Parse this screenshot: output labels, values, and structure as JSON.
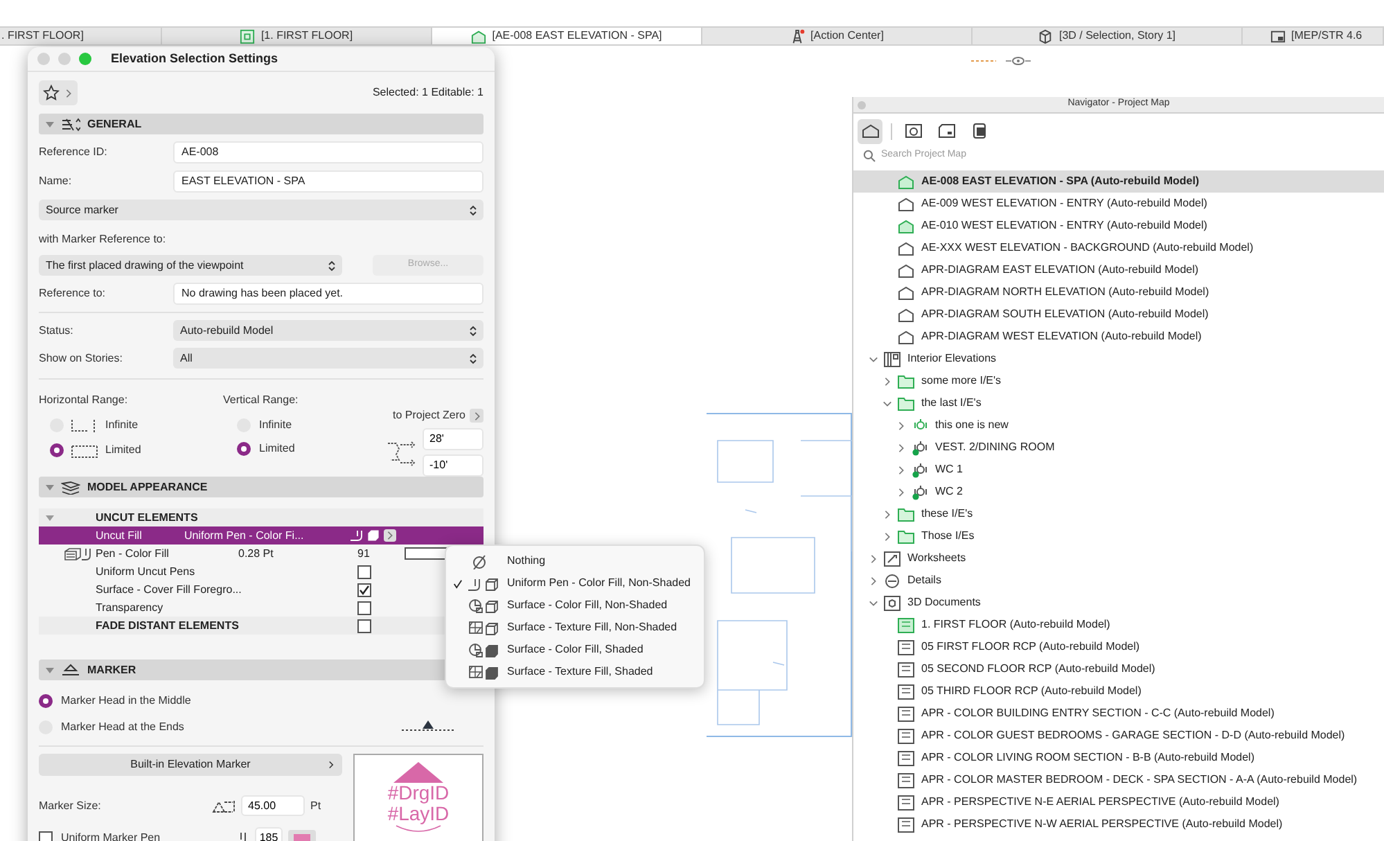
{
  "tabs": [
    {
      "label": ". FIRST FLOOR]",
      "kind": "none",
      "selected": false
    },
    {
      "label": "[1. FIRST FLOOR]",
      "kind": "plan",
      "selected": false
    },
    {
      "label": "[AE-008 EAST ELEVATION - SPA]",
      "kind": "elevation",
      "selected": true
    },
    {
      "label": "[Action Center]",
      "kind": "action",
      "selected": false
    },
    {
      "label": "[3D / Selection, Story 1]",
      "kind": "cube",
      "selected": false
    },
    {
      "label": "[MEP/STR 4.6",
      "kind": "layout",
      "selected": false
    }
  ],
  "dialog": {
    "title": "Elevation Selection Settings",
    "selection_info": "Selected: 1 Editable: 1",
    "general": {
      "title": "GENERAL",
      "expanded": true,
      "reference_id": {
        "label": "Reference ID:",
        "value": "AE-008"
      },
      "name": {
        "label": "Name:",
        "value": "EAST ELEVATION - SPA"
      },
      "marker_type": "Source marker",
      "marker_reference_label": "with Marker Reference to:",
      "marker_reference": "The first placed drawing of the viewpoint",
      "browse": {
        "label": "Browse...",
        "disabled": true
      },
      "reference_to": {
        "label": "Reference to:",
        "value": "No drawing has been placed yet."
      },
      "status": {
        "label": "Status:",
        "value": "Auto-rebuild Model"
      },
      "stories": {
        "label": "Show on Stories:",
        "value": "All"
      },
      "horizontal_range": {
        "label": "Horizontal Range:",
        "options": [
          {
            "label": "Infinite",
            "selected": false
          },
          {
            "label": "Limited",
            "selected": true
          }
        ]
      },
      "vertical_range": {
        "label": "Vertical Range:",
        "options": [
          {
            "label": "Infinite",
            "selected": false
          },
          {
            "label": "Limited",
            "selected": true
          }
        ]
      },
      "project_zero": "to Project Zero",
      "top": "28'",
      "bottom": "-10'"
    },
    "model_appearance": {
      "title": "MODEL APPEARANCE",
      "expanded": true,
      "rows": [
        {
          "kind": "group",
          "label": "UNCUT ELEMENTS",
          "expanded": true
        },
        {
          "kind": "option",
          "label": "Uncut Fill",
          "value": "Uniform Pen - Color Fi...",
          "selected": true
        },
        {
          "kind": "pen",
          "label": "Pen - Color Fill",
          "value": "0.28 Pt",
          "number": "91"
        },
        {
          "kind": "check",
          "label": "Uniform Uncut Pens",
          "checked": false
        },
        {
          "kind": "check",
          "label": "Surface - Cover Fill Foregro...",
          "checked": true
        },
        {
          "kind": "check",
          "label": "Transparency",
          "checked": false
        },
        {
          "kind": "group-check",
          "label": "FADE DISTANT ELEMENTS",
          "checked": false
        }
      ]
    },
    "marker": {
      "title": "MARKER",
      "expanded": true,
      "head_options": [
        {
          "label": "Marker Head in the Middle",
          "selected": true
        },
        {
          "label": "Marker Head at the Ends",
          "selected": false
        }
      ],
      "builtin_button": "Built-in Elevation Marker",
      "size": {
        "label": "Marker Size:",
        "value": "45.00",
        "unit": "Pt"
      },
      "uniform_pen": {
        "label": "Uniform Marker Pen",
        "checked": false,
        "pen": "185",
        "color": "#e27bb0"
      },
      "preview": [
        "#DrgID",
        "#LayID"
      ]
    }
  },
  "fill_menu": {
    "items": [
      {
        "kind": "none",
        "label": "Nothing",
        "selected": false
      },
      {
        "kind": "pen",
        "label": "Uniform Pen - Color Fill, Non-Shaded",
        "selected": true
      },
      {
        "kind": "surface-color",
        "label": "Surface - Color Fill, Non-Shaded",
        "selected": false
      },
      {
        "kind": "surface-texture",
        "label": "Surface - Texture Fill, Non-Shaded",
        "selected": false
      },
      {
        "kind": "surface-color-shaded",
        "label": "Surface - Color Fill, Shaded",
        "selected": false
      },
      {
        "kind": "surface-texture-shaded",
        "label": "Surface - Texture Fill, Shaded",
        "selected": false
      }
    ]
  },
  "navigator": {
    "title": "Navigator - Project Map",
    "view_buttons": [
      {
        "kind": "project",
        "selected": true
      },
      {
        "kind": "view",
        "selected": false
      },
      {
        "kind": "layout",
        "selected": false
      },
      {
        "kind": "publisher",
        "selected": false
      }
    ],
    "search_placeholder": "Search Project Map",
    "elevations": [
      {
        "label": "AE-008 EAST ELEVATION - SPA (Auto-rebuild Model)",
        "kind": "elevation-green",
        "selected": true
      },
      {
        "label": "AE-009 WEST ELEVATION - ENTRY (Auto-rebuild Model)",
        "kind": "elevation",
        "selected": false
      },
      {
        "label": "AE-010 WEST ELEVATION - ENTRY (Auto-rebuild Model)",
        "kind": "elevation-green",
        "selected": false
      },
      {
        "label": "AE-XXX WEST ELEVATION - BACKGROUND (Auto-rebuild Model)",
        "kind": "elevation",
        "selected": false
      },
      {
        "label": "APR-DIAGRAM EAST ELEVATION (Auto-rebuild Model)",
        "kind": "elevation",
        "selected": false
      },
      {
        "label": "APR-DIAGRAM NORTH ELEVATION (Auto-rebuild Model)",
        "kind": "elevation",
        "selected": false
      },
      {
        "label": "APR-DIAGRAM SOUTH ELEVATION (Auto-rebuild Model)",
        "kind": "elevation",
        "selected": false
      },
      {
        "label": "APR-DIAGRAM WEST ELEVATION (Auto-rebuild Model)",
        "kind": "elevation",
        "selected": false
      }
    ],
    "tree": [
      {
        "label": "Interior Elevations",
        "kind": "interior",
        "expanded": true,
        "selected": false,
        "children": [
          {
            "label": "some more I/E's",
            "kind": "folder",
            "expanded": false,
            "selected": false
          },
          {
            "label": "the last I/E's",
            "kind": "folder",
            "expanded": true,
            "selected": false,
            "children": [
              {
                "label": "this one is new",
                "kind": "ie-view",
                "expanded": false,
                "selected": false
              },
              {
                "label": "VEST. 2/DINING ROOM",
                "kind": "ie-view-dot",
                "expanded": false,
                "selected": false
              },
              {
                "label": "WC 1",
                "kind": "ie-view-dot",
                "expanded": false,
                "selected": false
              },
              {
                "label": "WC 2",
                "kind": "ie-view-dot",
                "expanded": false,
                "selected": false
              }
            ]
          },
          {
            "label": "these I/E's",
            "kind": "folder",
            "expanded": false,
            "selected": false
          },
          {
            "label": "Those I/Es",
            "kind": "folder",
            "expanded": false,
            "selected": false
          }
        ]
      },
      {
        "label": "Worksheets",
        "kind": "worksheet",
        "expanded": false,
        "selected": false
      },
      {
        "label": "Details",
        "kind": "detail",
        "expanded": false,
        "selected": false
      },
      {
        "label": "3D Documents",
        "kind": "documents",
        "expanded": true,
        "selected": false,
        "children": [
          {
            "label": "1. FIRST FLOOR (Auto-rebuild Model)",
            "kind": "doc-green",
            "selected": false
          },
          {
            "label": "05 FIRST FLOOR RCP (Auto-rebuild Model)",
            "kind": "doc",
            "selected": false
          },
          {
            "label": "05 SECOND FLOOR RCP (Auto-rebuild Model)",
            "kind": "doc",
            "selected": false
          },
          {
            "label": "05 THIRD FLOOR RCP (Auto-rebuild Model)",
            "kind": "doc",
            "selected": false
          },
          {
            "label": "APR - COLOR BUILDING ENTRY SECTION - C-C (Auto-rebuild Model)",
            "kind": "doc",
            "selected": false
          },
          {
            "label": "APR - COLOR GUEST BEDROOMS - GARAGE SECTION - D-D (Auto-rebuild Model)",
            "kind": "doc",
            "selected": false
          },
          {
            "label": "APR - COLOR LIVING ROOM SECTION - B-B (Auto-rebuild Model)",
            "kind": "doc",
            "selected": false
          },
          {
            "label": "APR - COLOR MASTER BEDROOM - DECK - SPA SECTION - A-A (Auto-rebuild Model)",
            "kind": "doc",
            "selected": false
          },
          {
            "label": "APR - PERSPECTIVE N-E AERIAL PERSPECTIVE (Auto-rebuild Model)",
            "kind": "doc",
            "selected": false
          },
          {
            "label": "APR - PERSPECTIVE N-W AERIAL PERSPECTIVE (Auto-rebuild Model)",
            "kind": "doc",
            "selected": false
          }
        ]
      }
    ]
  }
}
